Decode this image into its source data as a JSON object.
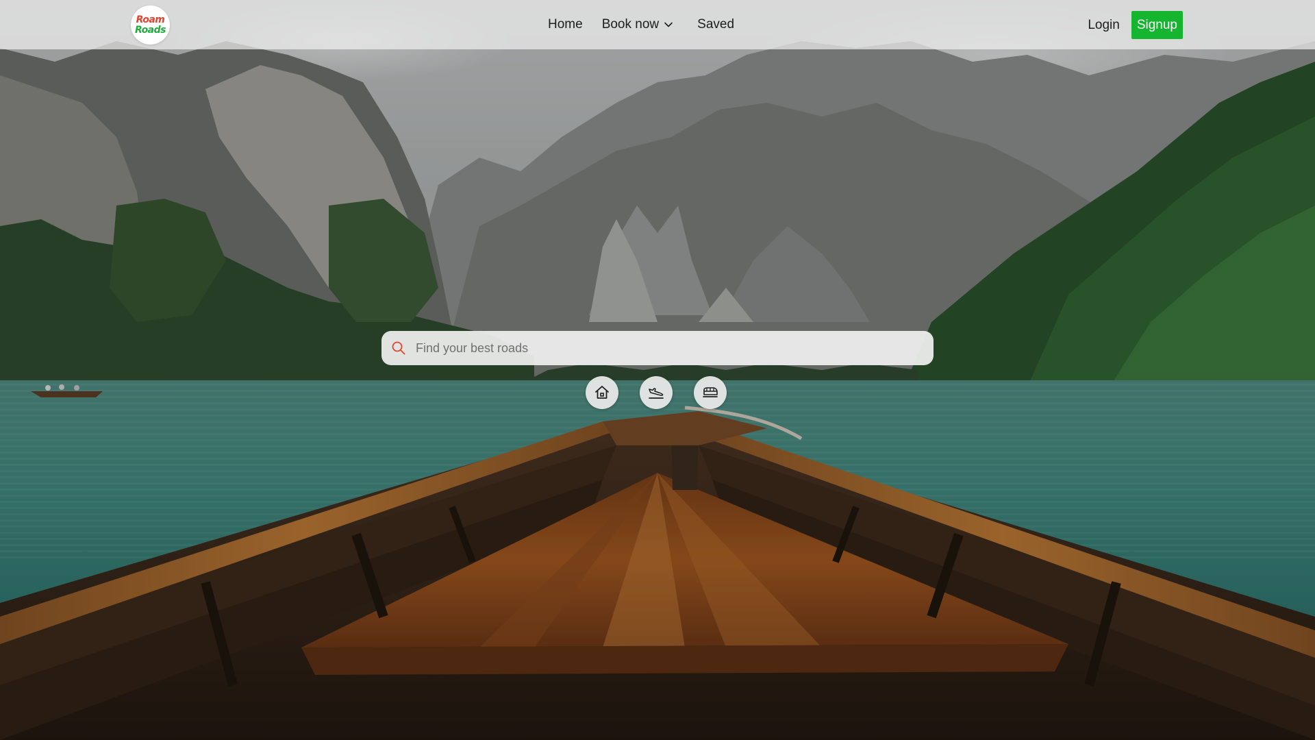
{
  "brand": {
    "logo_line1": "Roam",
    "logo_line2": "Roads"
  },
  "nav": {
    "home": "Home",
    "book_now": "Book now",
    "saved": "Saved"
  },
  "auth": {
    "login": "Login",
    "signup": "Signup"
  },
  "search": {
    "placeholder": "Find your best roads",
    "value": ""
  },
  "categories": [
    {
      "icon": "home-icon"
    },
    {
      "icon": "plane-landing-icon"
    },
    {
      "icon": "bus-icon"
    }
  ],
  "colors": {
    "signup_bg": "#16b52f",
    "logo_red": "#e8412c",
    "logo_green": "#1fae3b",
    "search_icon": "#e8412c"
  }
}
